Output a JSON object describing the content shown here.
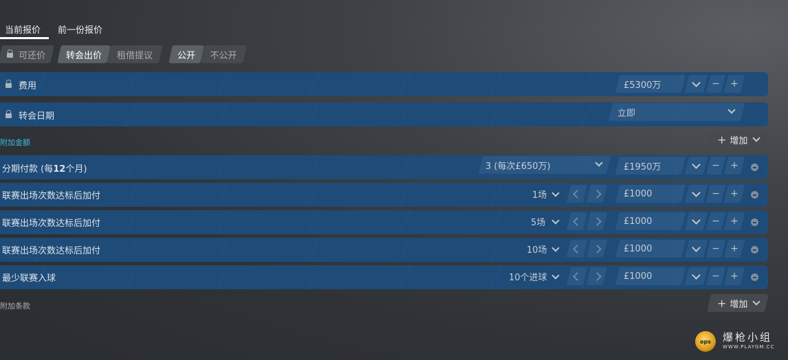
{
  "tabs": [
    {
      "label": "当前报价",
      "active": true
    },
    {
      "label": "前一份报价",
      "active": false
    }
  ],
  "toggles": {
    "negotiable": {
      "label": "可还价"
    },
    "offer_type": {
      "options": [
        "转会出价",
        "租借提议"
      ],
      "selected": "转会出价"
    },
    "visibility": {
      "options": [
        "公开",
        "不公开"
      ],
      "selected": "公开"
    }
  },
  "fee_row": {
    "label": "费用",
    "value": "£5300万"
  },
  "date_row": {
    "label": "转会日期",
    "value": "立即"
  },
  "add_ons_section": {
    "title": "附加金额",
    "add_label": "增加"
  },
  "installments_row": {
    "label_prefix": "分期付款 (每",
    "label_bold": "12",
    "label_suffix": "个月)",
    "plan_value": "3 (每次£650万)",
    "amount": "£1950万"
  },
  "bonus_rows": [
    {
      "label": "联赛出场次数达标后加付",
      "count": "1场",
      "amount": "£1000"
    },
    {
      "label": "联赛出场次数达标后加付",
      "count": "5场",
      "amount": "£1000"
    },
    {
      "label": "联赛出场次数达标后加付",
      "count": "10场",
      "amount": "£1000"
    },
    {
      "label": "最少联赛入球",
      "count": "10个进球",
      "amount": "£1000"
    }
  ],
  "clauses_section": {
    "title": "附加条款",
    "add_label": "增加"
  },
  "watermark": {
    "logo_text": "ops",
    "title": "爆枪小组",
    "url": "WWW.PLAYGM.CC"
  },
  "colors": {
    "accent_cyan": "#3fb7e6",
    "row_blue": "#1e4b78",
    "field_blue": "#2a5783"
  }
}
